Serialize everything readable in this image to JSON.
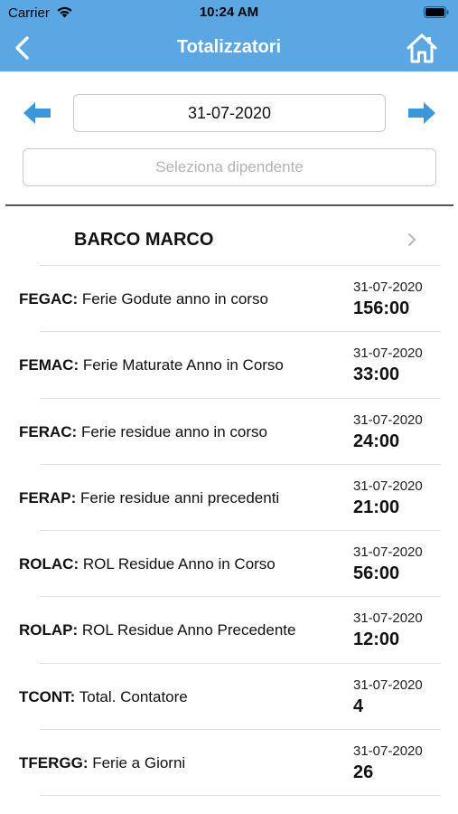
{
  "status_bar": {
    "carrier": "Carrier",
    "time": "10:24 AM"
  },
  "nav": {
    "title": "Totalizzatori"
  },
  "date_picker": {
    "value": "31-07-2020"
  },
  "employee_select": {
    "placeholder": "Seleziona dipendente"
  },
  "employee": {
    "name": "BARCO MARCO"
  },
  "colors": {
    "header": "#5aa7e4",
    "arrow": "#3b97dc"
  },
  "counters": [
    {
      "code": "FEGAC:",
      "label": " Ferie Godute anno in corso",
      "date": "31-07-2020",
      "value": "156:00"
    },
    {
      "code": "FEMAC:",
      "label": " Ferie Maturate Anno in Corso",
      "date": "31-07-2020",
      "value": "33:00"
    },
    {
      "code": "FERAC:",
      "label": " Ferie residue anno in corso",
      "date": "31-07-2020",
      "value": "24:00"
    },
    {
      "code": "FERAP:",
      "label": " Ferie residue anni precedenti",
      "date": "31-07-2020",
      "value": "21:00"
    },
    {
      "code": "ROLAC:",
      "label": " ROL Residue Anno in Corso",
      "date": "31-07-2020",
      "value": "56:00"
    },
    {
      "code": "ROLAP:",
      "label": " ROL Residue Anno Precedente",
      "date": "31-07-2020",
      "value": "12:00"
    },
    {
      "code": "TCONT:",
      "label": " Total. Contatore",
      "date": "31-07-2020",
      "value": "4"
    },
    {
      "code": "TFERGG:",
      "label": " Ferie a Giorni",
      "date": "31-07-2020",
      "value": "26"
    }
  ]
}
